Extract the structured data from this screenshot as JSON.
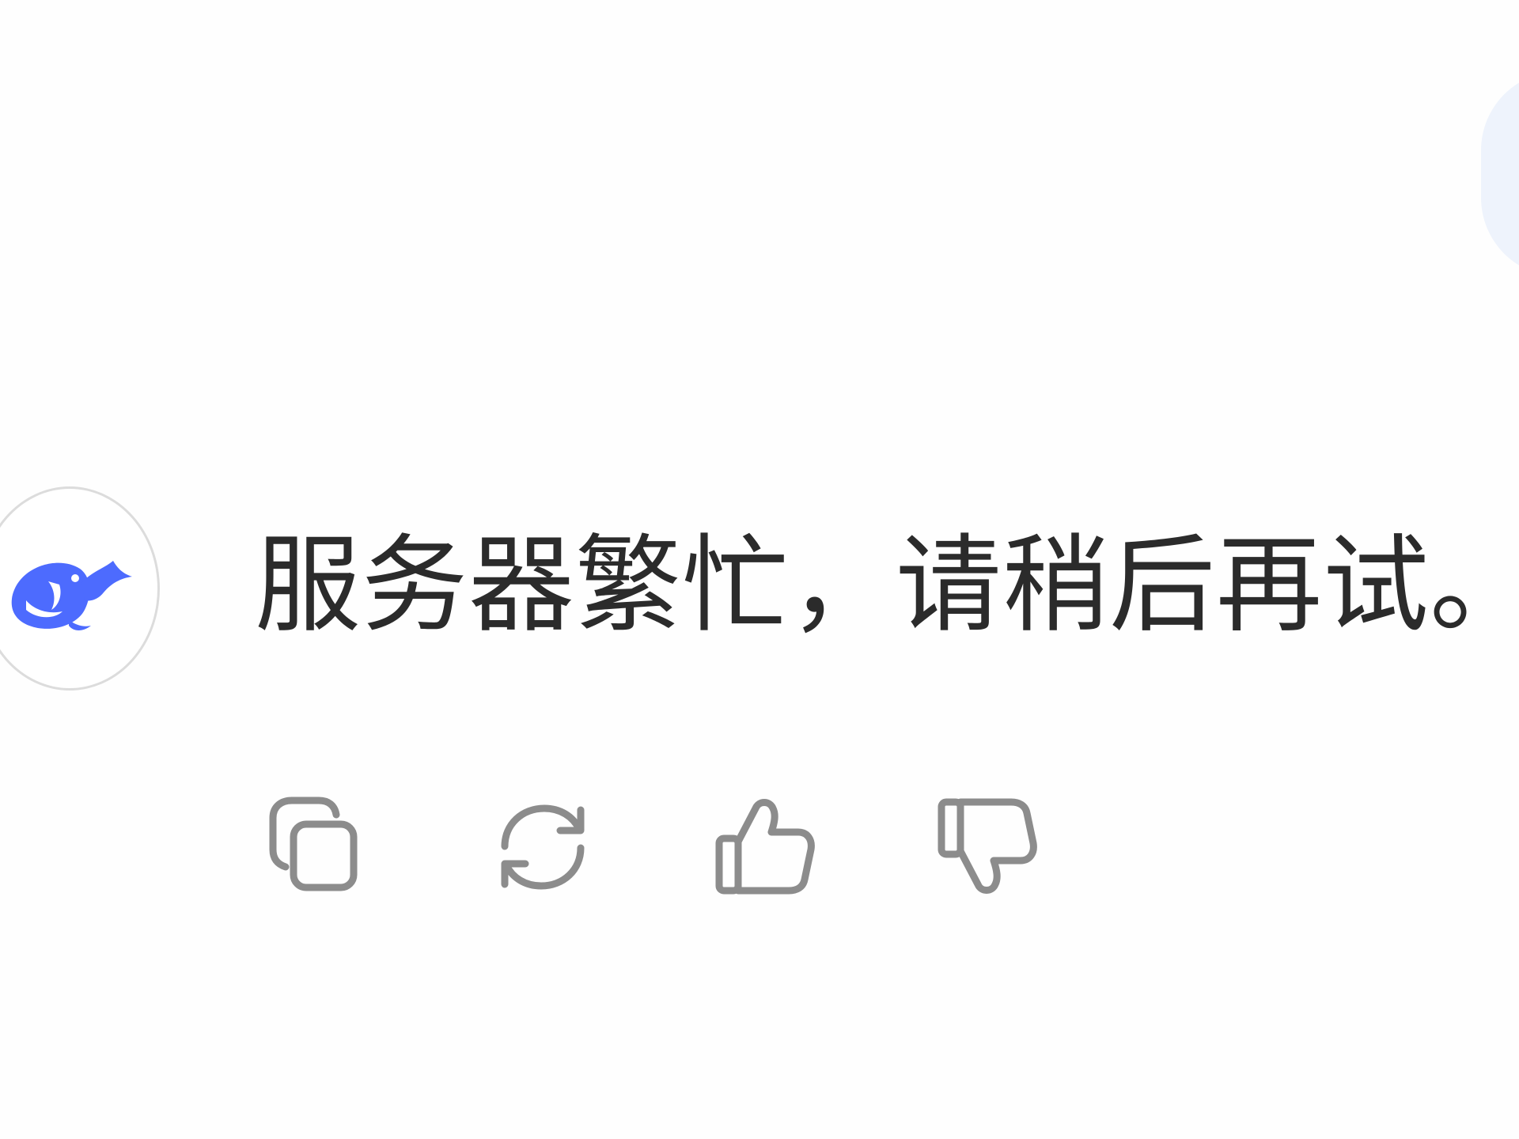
{
  "message": {
    "avatar_icon": "deepseek-whale-logo",
    "text": "服务器繁忙，请稍后再试。",
    "colors": {
      "text": "#2b2b2b",
      "logo": "#4d6bfe",
      "icons": "#8c8c8c",
      "avatar_border": "#dcdcdc",
      "user_bubble": "#eef3fc"
    }
  },
  "actions": [
    {
      "icon": "copy-icon"
    },
    {
      "icon": "regenerate-icon"
    },
    {
      "icon": "thumbs-up-icon"
    },
    {
      "icon": "thumbs-down-icon"
    }
  ]
}
